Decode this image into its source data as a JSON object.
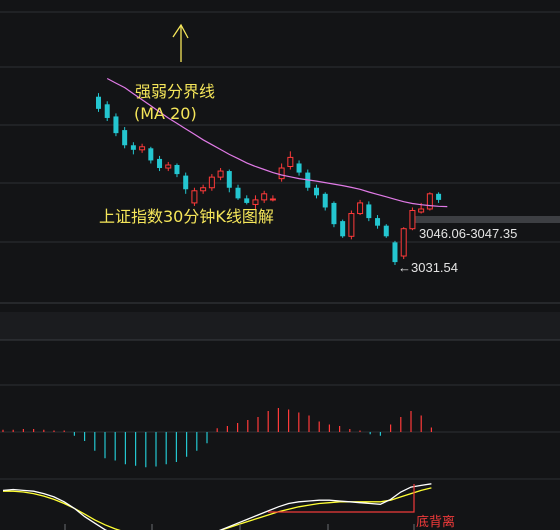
{
  "chart_data": {
    "type": "candlestick",
    "annotations": {
      "ma_label_line1": "强弱分界线",
      "ma_label_line2": "(MA 20)",
      "chart_title": "上证指数30分钟K线图解",
      "range_label": "3046.06-3047.35",
      "low_label": "←3031.54",
      "divergence_label": "底背离"
    },
    "price_scale": {
      "ref_value": 3046.7,
      "low_value": 3031.54
    },
    "candles": [
      {
        "o": 3087.0,
        "c": 3083.0,
        "h": 3088.2,
        "l": 3082.0
      },
      {
        "o": 3084.5,
        "c": 3080.0,
        "h": 3085.5,
        "l": 3079.0
      },
      {
        "o": 3080.5,
        "c": 3075.0,
        "h": 3081.5,
        "l": 3074.0
      },
      {
        "o": 3076.0,
        "c": 3071.0,
        "h": 3077.0,
        "l": 3070.0
      },
      {
        "o": 3071.0,
        "c": 3069.5,
        "h": 3072.0,
        "l": 3068.0
      },
      {
        "o": 3069.5,
        "c": 3070.5,
        "h": 3071.5,
        "l": 3068.5
      },
      {
        "o": 3070.0,
        "c": 3066.0,
        "h": 3070.5,
        "l": 3065.0
      },
      {
        "o": 3066.5,
        "c": 3063.5,
        "h": 3067.5,
        "l": 3062.5
      },
      {
        "o": 3063.5,
        "c": 3064.5,
        "h": 3065.5,
        "l": 3062.5
      },
      {
        "o": 3064.5,
        "c": 3061.5,
        "h": 3065.0,
        "l": 3060.5
      },
      {
        "o": 3061.0,
        "c": 3056.5,
        "h": 3062.0,
        "l": 3055.0
      },
      {
        "o": 3052.0,
        "c": 3056.0,
        "h": 3057.0,
        "l": 3051.0
      },
      {
        "o": 3056.0,
        "c": 3057.0,
        "h": 3058.0,
        "l": 3055.0
      },
      {
        "o": 3057.0,
        "c": 3060.5,
        "h": 3061.5,
        "l": 3056.0
      },
      {
        "o": 3060.5,
        "c": 3062.5,
        "h": 3063.5,
        "l": 3059.5
      },
      {
        "o": 3062.5,
        "c": 3057.0,
        "h": 3063.0,
        "l": 3055.5
      },
      {
        "o": 3057.0,
        "c": 3053.5,
        "h": 3058.0,
        "l": 3053.0
      },
      {
        "o": 3053.5,
        "c": 3052.0,
        "h": 3054.5,
        "l": 3051.5
      },
      {
        "o": 3051.5,
        "c": 3053.0,
        "h": 3054.5,
        "l": 3050.0
      },
      {
        "o": 3053.0,
        "c": 3055.0,
        "h": 3056.0,
        "l": 3052.0
      },
      {
        "o": 3053.0,
        "c": 3053.3,
        "h": 3054.5,
        "l": 3052.5
      },
      {
        "o": 3060.0,
        "c": 3063.5,
        "h": 3065.0,
        "l": 3059.0
      },
      {
        "o": 3064.0,
        "c": 3067.0,
        "h": 3069.0,
        "l": 3063.0
      },
      {
        "o": 3065.0,
        "c": 3062.0,
        "h": 3066.0,
        "l": 3061.0
      },
      {
        "o": 3062.0,
        "c": 3057.0,
        "h": 3063.0,
        "l": 3056.0
      },
      {
        "o": 3057.0,
        "c": 3054.5,
        "h": 3058.0,
        "l": 3053.5
      },
      {
        "o": 3055.0,
        "c": 3050.5,
        "h": 3055.5,
        "l": 3049.5
      },
      {
        "o": 3052.0,
        "c": 3045.0,
        "h": 3052.5,
        "l": 3044.0
      },
      {
        "o": 3046.0,
        "c": 3041.0,
        "h": 3046.5,
        "l": 3040.5
      },
      {
        "o": 3041.0,
        "c": 3048.5,
        "h": 3049.5,
        "l": 3040.0
      },
      {
        "o": 3048.5,
        "c": 3052.0,
        "h": 3053.0,
        "l": 3048.0
      },
      {
        "o": 3051.5,
        "c": 3047.0,
        "h": 3052.5,
        "l": 3046.0
      },
      {
        "o": 3047.0,
        "c": 3044.5,
        "h": 3048.0,
        "l": 3043.5
      },
      {
        "o": 3044.5,
        "c": 3041.0,
        "h": 3045.0,
        "l": 3040.5
      },
      {
        "o": 3039.0,
        "c": 3032.5,
        "h": 3039.5,
        "l": 3031.54
      },
      {
        "o": 3034.5,
        "c": 3043.5,
        "h": 3044.0,
        "l": 3033.5
      },
      {
        "o": 3043.5,
        "c": 3049.5,
        "h": 3050.5,
        "l": 3043.0
      },
      {
        "o": 3049.0,
        "c": 3050.0,
        "h": 3052.0,
        "l": 3048.5
      },
      {
        "o": 3050.0,
        "c": 3055.0,
        "h": 3055.5,
        "l": 3049.5
      },
      {
        "o": 3055.0,
        "c": 3053.0,
        "h": 3055.5,
        "l": 3052.0
      }
    ],
    "ma20": [
      3093.0,
      3091.5,
      3090.0,
      3088.0,
      3086.0,
      3084.0,
      3082.0,
      3080.0,
      3078.2,
      3076.4,
      3074.6,
      3072.8,
      3071.2,
      3069.6,
      3068.0,
      3066.6,
      3065.2,
      3064.0,
      3063.0,
      3062.0,
      3061.2,
      3060.6,
      3060.0,
      3059.6,
      3059.2,
      3058.7,
      3058.2,
      3057.7,
      3057.1,
      3056.5,
      3055.6,
      3054.8,
      3054.0,
      3053.2,
      3052.4,
      3051.8,
      3051.4,
      3051.1,
      3050.9,
      3050.8
    ],
    "macd_hist": [
      0.3,
      0.3,
      0.4,
      0.4,
      0.3,
      0.2,
      0.2,
      -0.5,
      -1.2,
      -2.5,
      -3.5,
      -3.8,
      -4.3,
      -4.5,
      -4.7,
      -4.6,
      -4.3,
      -4.0,
      -3.3,
      -2.5,
      -1.5,
      0.5,
      0.8,
      1.2,
      1.6,
      2.0,
      2.8,
      3.2,
      3.0,
      2.6,
      2.2,
      1.4,
      1.0,
      0.8,
      0.4,
      0.2,
      -0.3,
      -0.5,
      1.0,
      2.0,
      2.8,
      2.2,
      0.6
    ],
    "dif": [
      0.2,
      0.3,
      0.2,
      0.1,
      -0.2,
      -0.6,
      -1.2,
      -2.0,
      -3.0,
      -3.8,
      -4.6,
      -5.2,
      -5.7,
      -6.1,
      -6.4,
      -6.6,
      -6.6,
      -6.4,
      -6.1,
      -5.7,
      -5.3,
      -4.8,
      -4.3,
      -3.8,
      -3.3,
      -2.8,
      -2.3,
      -1.8,
      -1.4,
      -1.2,
      -1.1,
      -1.0,
      -1.0,
      -1.1,
      -1.2,
      -1.3,
      -1.4,
      -1.5,
      -0.9,
      0.0,
      0.6,
      0.8,
      1.0
    ],
    "dea": [
      0.1,
      0.1,
      0.0,
      -0.2,
      -0.5,
      -0.9,
      -1.4,
      -2.0,
      -2.7,
      -3.4,
      -4.0,
      -4.5,
      -4.9,
      -5.2,
      -5.4,
      -5.6,
      -5.7,
      -5.7,
      -5.6,
      -5.4,
      -5.1,
      -4.8,
      -4.4,
      -4.0,
      -3.6,
      -3.2,
      -2.8,
      -2.4,
      -2.1,
      -1.8,
      -1.6,
      -1.4,
      -1.3,
      -1.2,
      -1.2,
      -1.2,
      -1.2,
      -1.2,
      -1.0,
      -0.6,
      -0.2,
      0.2,
      0.5
    ],
    "colors": {
      "up": "#ff3a3a",
      "down": "#24c6d0",
      "ma20": "#e07ae6",
      "dif": "#ffffff",
      "dea": "#ffff33",
      "grid": "#2e3034",
      "annot": "#f5e65a",
      "divergence": "#f03a3a"
    }
  }
}
